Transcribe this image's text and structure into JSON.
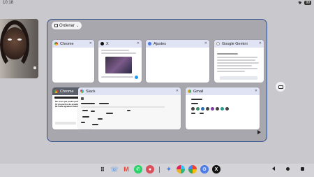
{
  "status": {
    "time": "10:18",
    "battery": "99"
  },
  "overview": {
    "sort_label": "Ordenar",
    "cards": [
      {
        "title": "Chrome",
        "icon": "chrome-icon"
      },
      {
        "title": "X",
        "icon": "x-icon"
      },
      {
        "title": "Ajustes",
        "icon": "settings-icon"
      },
      {
        "title": "Google Gemini",
        "icon": "gemini-icon"
      },
      {
        "title": "Chrome",
        "icon": "chrome-icon",
        "snippet": "No creo que podré publicar este de 10 proyectos de prueba necesarias. Mi meta agradece felicidades."
      },
      {
        "title": "Slack",
        "icon": "slack-icon"
      },
      {
        "title": "Gmail",
        "icon": "gmail-icon"
      }
    ]
  },
  "dock": {
    "apps": [
      "launcher-icon",
      "phone-icon",
      "gmail-icon",
      "whatsapp-icon",
      "avatar-app-icon",
      "gemini-icon",
      "slack-icon",
      "photos-icon",
      "settings-icon",
      "x-icon"
    ]
  },
  "colors": {
    "accent_border": "#2f4f8c",
    "card_header": "#dfe3f4",
    "background": "#c9c9cd"
  }
}
